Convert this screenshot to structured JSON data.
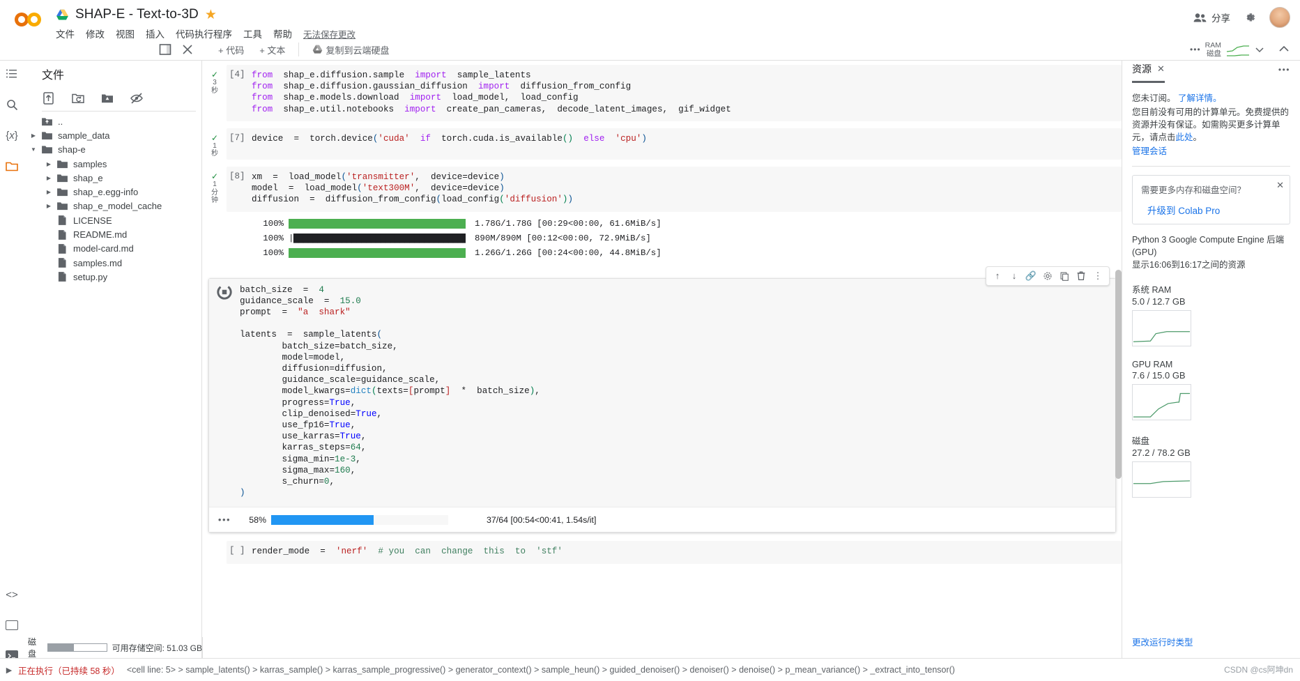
{
  "app": {
    "logo": "colab-logo"
  },
  "header": {
    "notebook_title": "SHAP-E - Text-to-3D",
    "star": "★",
    "menus": [
      "文件",
      "修改",
      "视图",
      "插入",
      "代码执行程序",
      "工具",
      "帮助"
    ],
    "save_status": "无法保存更改",
    "share_label": "分享",
    "settings_icon": "gear-icon",
    "avatar": "avatar"
  },
  "toolbar": {
    "add_code": "+ 代码",
    "add_text": "+ 文本",
    "copy_to_drive": "复制到云端硬盘",
    "ram_label": "RAM",
    "disk_label": "磁盘"
  },
  "files_panel": {
    "title": "文件",
    "tools": [
      "upload-icon",
      "refresh-folder-icon",
      "mount-drive-icon",
      "hide-hidden-icon"
    ],
    "tree": [
      {
        "label": "..",
        "type": "up",
        "indent": 0,
        "arrow": false
      },
      {
        "label": "sample_data",
        "type": "folder",
        "indent": 0,
        "arrow": "collapsed"
      },
      {
        "label": "shap-e",
        "type": "folder",
        "indent": 0,
        "arrow": "expanded"
      },
      {
        "label": "samples",
        "type": "folder",
        "indent": 1,
        "arrow": "collapsed"
      },
      {
        "label": "shap_e",
        "type": "folder",
        "indent": 1,
        "arrow": "collapsed"
      },
      {
        "label": "shap_e.egg-info",
        "type": "folder",
        "indent": 1,
        "arrow": "collapsed"
      },
      {
        "label": "shap_e_model_cache",
        "type": "folder",
        "indent": 1,
        "arrow": "collapsed"
      },
      {
        "label": "LICENSE",
        "type": "file",
        "indent": 1,
        "arrow": false
      },
      {
        "label": "README.md",
        "type": "file",
        "indent": 1,
        "arrow": false
      },
      {
        "label": "model-card.md",
        "type": "file",
        "indent": 1,
        "arrow": false
      },
      {
        "label": "samples.md",
        "type": "file",
        "indent": 1,
        "arrow": false
      },
      {
        "label": "setup.py",
        "type": "file",
        "indent": 1,
        "arrow": false
      }
    ]
  },
  "notebook": {
    "cells": [
      {
        "index": "[4]",
        "status": "✓",
        "time": "3\n秒",
        "code_html": "<span class=\"k\">from</span>  shap_e.diffusion.sample  <span class=\"k\">import</span>  sample_latents\n<span class=\"k\">from</span>  shap_e.diffusion.gaussian_diffusion  <span class=\"k\">import</span>  diffusion_from_config\n<span class=\"k\">from</span>  shap_e.models.download  <span class=\"k\">import</span>  load_model,  load_config\n<span class=\"k\">from</span>  shap_e.util.notebooks  <span class=\"k\">import</span>  create_pan_cameras,  decode_latent_images,  gif_widget"
      },
      {
        "index": "[7]",
        "status": "✓",
        "time": "1\n秒",
        "code_html": "device  =  torch.device<span class=\"p\">(</span><span class=\"s\">'cuda'</span>  <span class=\"k\">if</span>  torch.cuda.is_available<span class=\"g\">()</span>  <span class=\"k\">else</span>  <span class=\"s\">'cpu'</span><span class=\"p\">)</span>"
      },
      {
        "index": "[8]",
        "status": "✓",
        "time": "1\n分\n钟",
        "code_html": "xm  =  load_model<span class=\"p\">(</span><span class=\"s\">'transmitter'</span>,  device=device<span class=\"p\">)</span>\nmodel  =  load_model<span class=\"p\">(</span><span class=\"s\">'text300M'</span>,  device=device<span class=\"p\">)</span>\ndiffusion  =  diffusion_from_config<span class=\"p\">(</span>load_config<span class=\"g\">(</span><span class=\"s\">'diffusion'</span><span class=\"g\">)</span><span class=\"p\">)</span>"
      }
    ],
    "download_bars": [
      {
        "percent": "100%",
        "fill": 100,
        "style": "green",
        "text": "1.78G/1.78G [00:29<00:00, 61.6MiB/s]"
      },
      {
        "percent": "100%",
        "fill": 100,
        "style": "ascii",
        "ascii": "|██████████████████████████████████████████|",
        "text": "890M/890M [00:12<00:00, 72.9MiB/s]"
      },
      {
        "percent": "100%",
        "fill": 100,
        "style": "green",
        "text": "1.26G/1.26G [00:24<00:00, 44.8MiB/s]"
      }
    ],
    "selected_cell": {
      "toolbar_icons": [
        "move-up-icon",
        "move-down-icon",
        "link-icon",
        "settings-icon",
        "copy-icon",
        "delete-icon",
        "more-vert-icon"
      ],
      "run_icon": "stop-icon",
      "code_html": "batch_size  =  <span class=\"n\">4</span>\nguidance_scale  =  <span class=\"n\">15.0</span>\nprompt  =  <span class=\"s\">\"a  shark\"</span>\n\nlatents  =  sample_latents<span class=\"p\">(</span>\n        batch_size=batch_size,\n        model=model,\n        diffusion=diffusion,\n        guidance_scale=guidance_scale,\n        model_kwargs=<span class=\"fn\">dict</span><span class=\"g\">(</span>texts=<span class=\"s\">[</span>prompt<span class=\"s\">]</span>  *  batch_size<span class=\"g\">)</span>,\n        progress=<span class=\"b\">True</span>,\n        clip_denoised=<span class=\"b\">True</span>,\n        use_fp16=<span class=\"b\">True</span>,\n        use_karras=<span class=\"b\">True</span>,\n        karras_steps=<span class=\"n\">64</span>,\n        sigma_min=<span class=\"n\">1e-3</span>,\n        sigma_max=<span class=\"n\">160</span>,\n        s_churn=<span class=\"n\">0</span>,\n<span class=\"p\">)</span>",
      "progress": {
        "dots": "•••",
        "percent": "58%",
        "fill": 58,
        "text": "37/64 [00:54<00:41, 1.54s/it]"
      }
    },
    "next_cell": {
      "index": "[ ]",
      "code_html": "render_mode  =  <span class=\"s\">'nerf'</span>  <span class=\"c\"># you  can  change  this  to  'stf'</span>"
    }
  },
  "resources_panel": {
    "tab": "资源",
    "close_icon": "close-icon",
    "more_icon": "more-horiz-icon",
    "line1_a": "您未订阅。",
    "line1_link": "了解详情。",
    "body": "您目前没有可用的计算单元。免费提供的资源并没有保证。如需购买更多计算单元，请点击",
    "body_link": "此处",
    "body_end": "。",
    "manage_session": "管理会话",
    "promo_title": "需要更多内存和磁盘空间？",
    "promo_link": "升级到 Colab Pro",
    "backend": "Python 3 Google Compute Engine 后端 (GPU)",
    "time_range": "显示16:06到16:17之间的资源",
    "meters": [
      {
        "name": "系统 RAM",
        "value": "5.0 / 12.7 GB"
      },
      {
        "name": "GPU RAM",
        "value": "7.6 / 15.0 GB"
      },
      {
        "name": "磁盘",
        "value": "27.2 / 78.2 GB"
      }
    ],
    "change_runtime": "更改运行时类型"
  },
  "bottom": {
    "disk_label": "磁盘",
    "disk_fill": 45,
    "free_space": "可用存储空间: 51.03 GB",
    "executing": "正在执行（已持续 58 秒）",
    "trace": "<cell line: 5> > sample_latents() > karras_sample() > karras_sample_progressive() > generator_context() > sample_heun() > guided_denoiser() > denoiser() > denoise() > p_mean_variance() > _extract_into_tensor()",
    "watermark": "CSDN @cs阿坤dn"
  }
}
